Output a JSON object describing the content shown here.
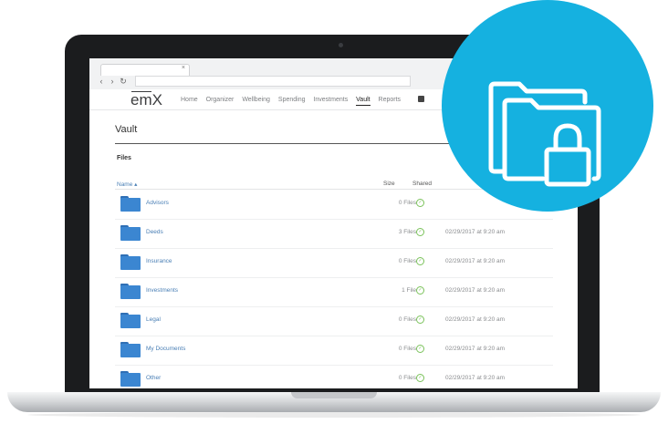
{
  "app": {
    "logo": "emX"
  },
  "nav": {
    "items": [
      "Home",
      "Organizer",
      "Wellbeing",
      "Spending",
      "Investments",
      "Vault",
      "Reports"
    ],
    "active": "Vault"
  },
  "page": {
    "title": "Vault",
    "section": "Files"
  },
  "table": {
    "headers": {
      "name": "Name ▴",
      "size": "Size",
      "shared": "Shared"
    },
    "rows": [
      {
        "name": "Advisors",
        "size": "0 Files",
        "date": ""
      },
      {
        "name": "Deeds",
        "size": "3 Files",
        "date": "02/29/2017 at 9:20 am"
      },
      {
        "name": "Insurance",
        "size": "0 Files",
        "date": "02/29/2017 at 9:20 am"
      },
      {
        "name": "Investments",
        "size": "1 File",
        "date": "02/29/2017 at 9:20 am"
      },
      {
        "name": "Legal",
        "size": "0 Files",
        "date": "02/29/2017 at 9:20 am"
      },
      {
        "name": "My Documents",
        "size": "0 Files",
        "date": "02/29/2017 at 9:20 am"
      },
      {
        "name": "Other",
        "size": "0 Files",
        "date": "02/29/2017 at 9:20 am"
      }
    ]
  },
  "icons": {
    "badge": "folder-lock-icon",
    "shared": "check-circle-icon",
    "folder": "folder-icon"
  },
  "colors": {
    "accent": "#15b1e0",
    "folder": "#3b86d1",
    "link": "#4a7fb5",
    "shared": "#7ac25a"
  }
}
